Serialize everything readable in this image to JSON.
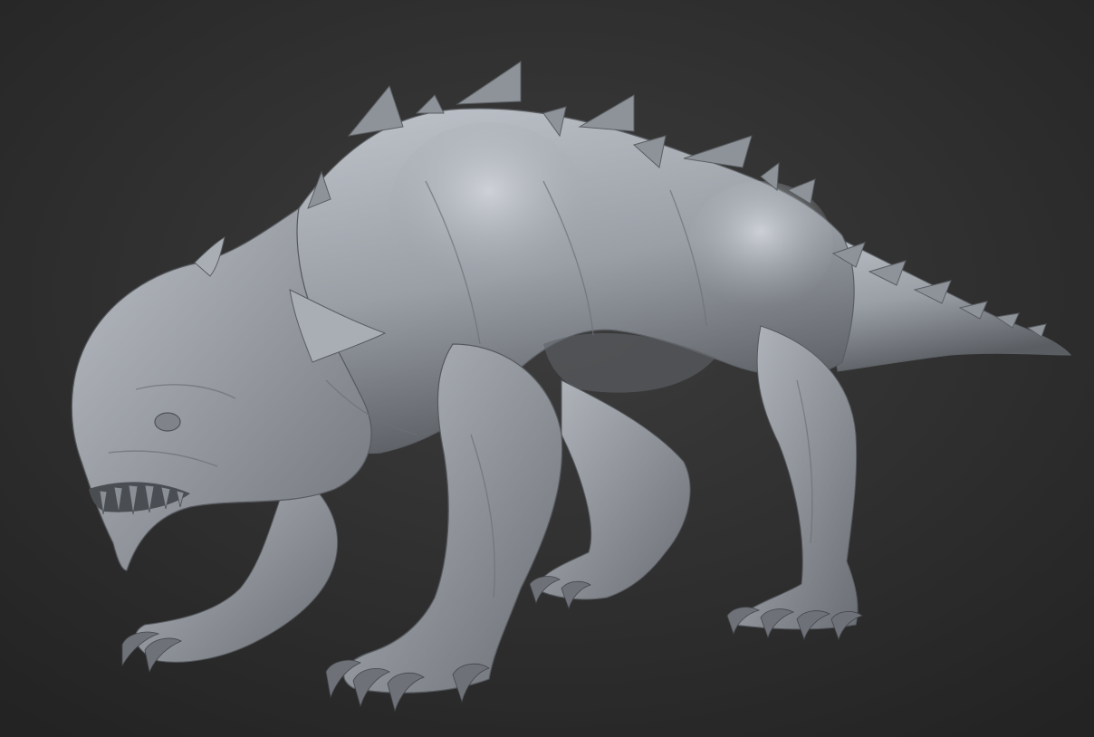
{
  "viewport": {
    "background_top": "#3d3d3d",
    "background_bottom": "#232323",
    "model_color": "#9a9fa6",
    "model_highlight": "#c8ccd3",
    "model_shadow": "#4f5358",
    "spike_color": "#8e939a",
    "claw_color": "#6e7278",
    "teeth_color": "#7b8086",
    "object": "sculpted-creature-icon"
  }
}
